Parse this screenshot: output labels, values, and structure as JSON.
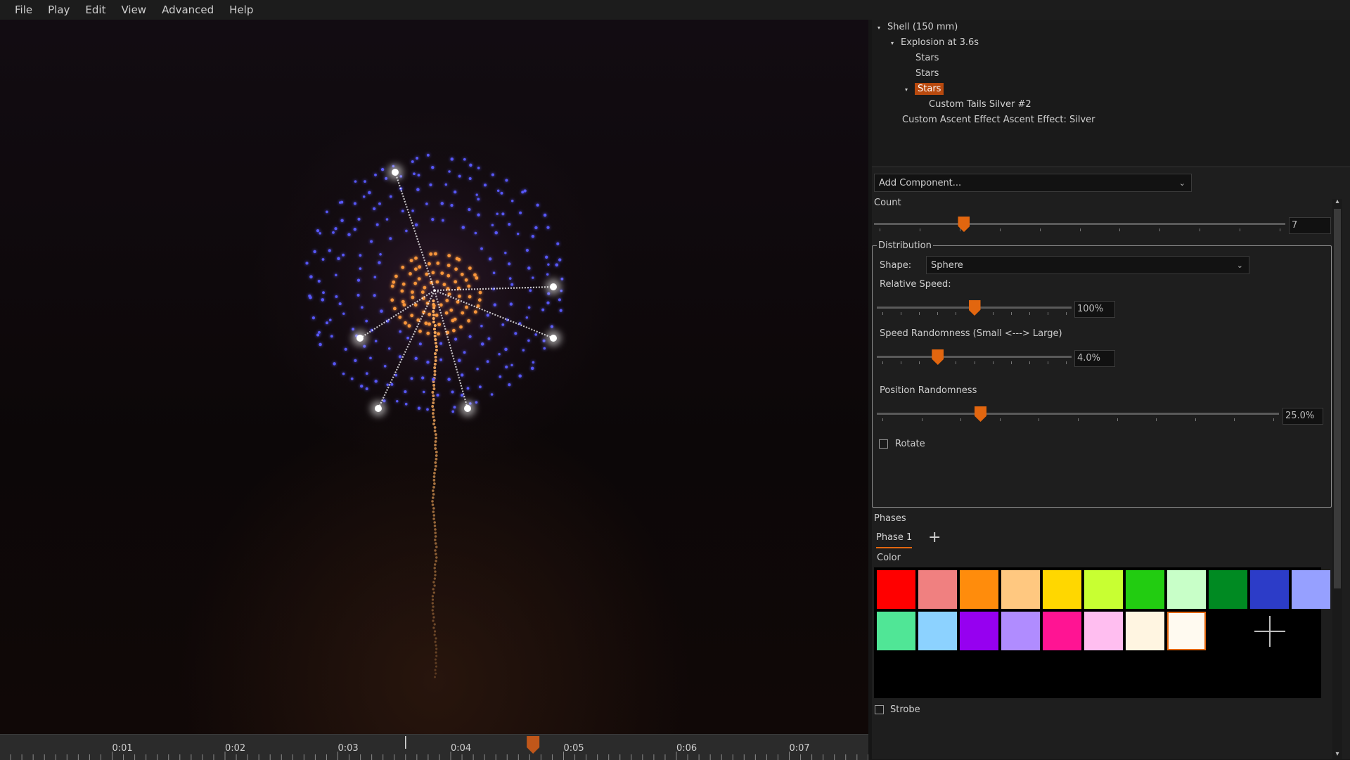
{
  "menu": [
    "File",
    "Play",
    "Edit",
    "View",
    "Advanced",
    "Help"
  ],
  "tree": {
    "shell": "Shell (150 mm)",
    "explosion": "Explosion at 3.6s",
    "stars_1": "Stars",
    "stars_2": "Stars",
    "stars_selected": "Stars",
    "custom_tails": "Custom Tails Silver #2",
    "ascent_effect": "Custom Ascent Effect Ascent Effect: Silver"
  },
  "add_component": "Add Component...",
  "count": {
    "label": "Count",
    "value": "7",
    "slider_fraction": 0.21
  },
  "distribution": {
    "title": "Distribution",
    "shape_label": "Shape:",
    "shape_value": "Sphere",
    "relative_speed": {
      "label": "Relative Speed:",
      "value": "100%",
      "slider_fraction": 0.5
    },
    "speed_randomness": {
      "label": "Speed Randomness (Small <---> Large)",
      "value": "4.0%",
      "slider_fraction": 0.3
    },
    "position_randomness": {
      "label": "Position Randomness",
      "value": "25.0%",
      "slider_fraction": 0.25
    },
    "rotate_label": "Rotate"
  },
  "phases": {
    "label": "Phases",
    "tab": "Phase 1"
  },
  "color_label": "Color",
  "colors": [
    "#ff0000",
    "#f08080",
    "#ff8c0c",
    "#ffc880",
    "#ffd700",
    "#c8ff32",
    "#22cc11",
    "#c8ffc8",
    "#008a22",
    "#2c3cc8",
    "#96a0ff",
    "#50e696",
    "#8cd2ff",
    "#9600f0",
    "#b08cff",
    "#ff1493",
    "#ffbef0",
    "#fff5e1",
    "#fffaf0"
  ],
  "selected_color_index": 18,
  "strobe_label": "Strobe",
  "timeline": {
    "labels": [
      "0:01",
      "0:02",
      "0:03",
      "0:04",
      "0:05",
      "0:06",
      "0:07"
    ],
    "playhead_time": 4.73,
    "marker_time": 3.6
  },
  "firework_colors": {
    "outer": "#5a5aff",
    "inner": "#ff9a3c",
    "tails": "#ffffff",
    "ascent": "#ffb060"
  }
}
